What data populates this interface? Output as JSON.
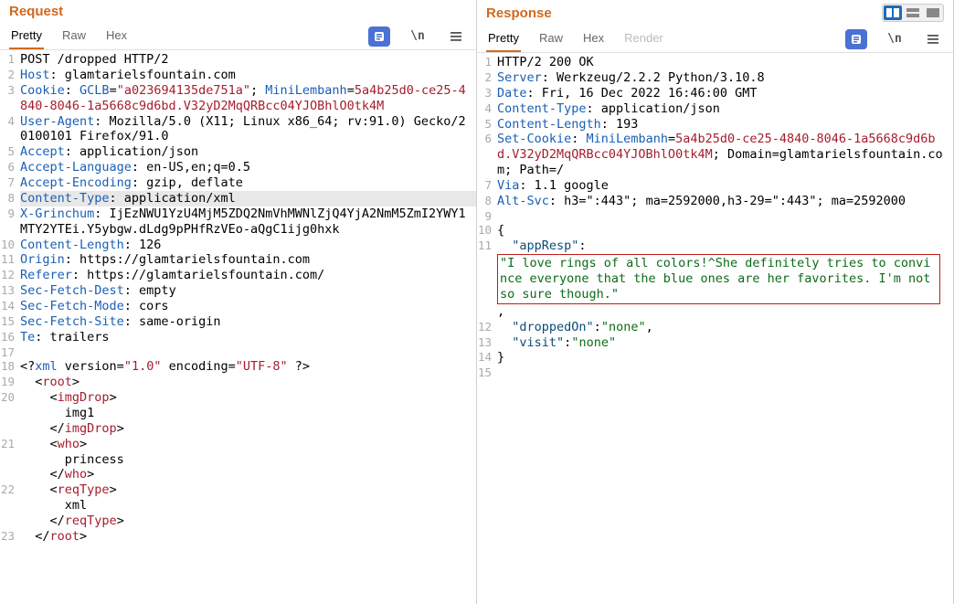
{
  "request": {
    "title": "Request",
    "tabs": {
      "pretty": "Pretty",
      "raw": "Raw",
      "hex": "Hex"
    },
    "tool_newline": "\\n",
    "lines": [
      {
        "n": "1",
        "spans": [
          {
            "t": "POST /dropped HTTP/2"
          }
        ]
      },
      {
        "n": "2",
        "spans": [
          {
            "t": "Host",
            "c": "hk"
          },
          {
            "t": ": glamtarielsfountain.com"
          }
        ]
      },
      {
        "n": "3",
        "spans": [
          {
            "t": "Cookie",
            "c": "hk"
          },
          {
            "t": ": "
          },
          {
            "t": "GCLB",
            "c": "hk"
          },
          {
            "t": "="
          },
          {
            "t": "\"a023694135de751a\"",
            "c": "cs"
          },
          {
            "t": "; "
          },
          {
            "t": "MiniLembanh",
            "c": "hk"
          },
          {
            "t": "="
          },
          {
            "t": "5a4b25d0-ce25-4840-8046-1a5668c9d6bd.V32yD2MqQRBcc04YJOBhlO0tk4M",
            "c": "cs"
          }
        ]
      },
      {
        "n": "4",
        "spans": [
          {
            "t": "User-Agent",
            "c": "hk"
          },
          {
            "t": ": Mozilla/5.0 (X11; Linux x86_64; rv:91.0) Gecko/20100101 Firefox/91.0"
          }
        ]
      },
      {
        "n": "5",
        "spans": [
          {
            "t": "Accept",
            "c": "hk"
          },
          {
            "t": ": application/json"
          }
        ]
      },
      {
        "n": "6",
        "spans": [
          {
            "t": "Accept-Language",
            "c": "hk"
          },
          {
            "t": ": en-US,en;q=0.5"
          }
        ]
      },
      {
        "n": "7",
        "spans": [
          {
            "t": "Accept-Encoding",
            "c": "hk"
          },
          {
            "t": ": gzip, deflate"
          }
        ]
      },
      {
        "n": "8",
        "hl": true,
        "spans": [
          {
            "t": "Content-Type",
            "c": "hk"
          },
          {
            "t": ": application/xml"
          }
        ]
      },
      {
        "n": "9",
        "spans": [
          {
            "t": "X-Grinchum",
            "c": "hk"
          },
          {
            "t": ": IjEzNWU1YzU4MjM5ZDQ2NmVhMWNlZjQ4YjA2NmM5ZmI2YWY1MTY2YTEi.Y5ybgw.dLdg9pPHfRzVEo-aQgC1ijg0hxk"
          }
        ]
      },
      {
        "n": "10",
        "spans": [
          {
            "t": "Content-Length",
            "c": "hk"
          },
          {
            "t": ": 126"
          }
        ]
      },
      {
        "n": "11",
        "spans": [
          {
            "t": "Origin",
            "c": "hk"
          },
          {
            "t": ": https://glamtarielsfountain.com"
          }
        ]
      },
      {
        "n": "12",
        "spans": [
          {
            "t": "Referer",
            "c": "hk"
          },
          {
            "t": ": https://glamtarielsfountain.com/"
          }
        ]
      },
      {
        "n": "13",
        "spans": [
          {
            "t": "Sec-Fetch-Dest",
            "c": "hk"
          },
          {
            "t": ": empty"
          }
        ]
      },
      {
        "n": "14",
        "spans": [
          {
            "t": "Sec-Fetch-Mode",
            "c": "hk"
          },
          {
            "t": ": cors"
          }
        ]
      },
      {
        "n": "15",
        "spans": [
          {
            "t": "Sec-Fetch-Site",
            "c": "hk"
          },
          {
            "t": ": same-origin"
          }
        ]
      },
      {
        "n": "16",
        "spans": [
          {
            "t": "Te",
            "c": "hk"
          },
          {
            "t": ": trailers"
          }
        ]
      },
      {
        "n": "17",
        "spans": [
          {
            "t": ""
          }
        ]
      },
      {
        "n": "18",
        "spans": [
          {
            "t": "<?"
          },
          {
            "t": "xml",
            "c": "hk"
          },
          {
            "t": " version="
          },
          {
            "t": "\"1.0\"",
            "c": "cs"
          },
          {
            "t": " encoding="
          },
          {
            "t": "\"UTF-8\"",
            "c": "cs"
          },
          {
            "t": " ?>"
          }
        ]
      },
      {
        "n": "19",
        "spans": [
          {
            "t": "  <"
          },
          {
            "t": "root",
            "c": "cs"
          },
          {
            "t": ">"
          }
        ]
      },
      {
        "n": "20",
        "spans": [
          {
            "t": "    <"
          },
          {
            "t": "imgDrop",
            "c": "cs"
          },
          {
            "t": ">\n      img1\n    </"
          },
          {
            "t": "imgDrop",
            "c": "cs"
          },
          {
            "t": ">"
          }
        ]
      },
      {
        "n": "21",
        "spans": [
          {
            "t": "    <"
          },
          {
            "t": "who",
            "c": "cs"
          },
          {
            "t": ">\n      princess\n    </"
          },
          {
            "t": "who",
            "c": "cs"
          },
          {
            "t": ">"
          }
        ]
      },
      {
        "n": "22",
        "spans": [
          {
            "t": "    <"
          },
          {
            "t": "reqType",
            "c": "cs"
          },
          {
            "t": ">\n      xml\n    </"
          },
          {
            "t": "reqType",
            "c": "cs"
          },
          {
            "t": ">"
          }
        ]
      },
      {
        "n": "23",
        "spans": [
          {
            "t": "  </"
          },
          {
            "t": "root",
            "c": "cs"
          },
          {
            "t": ">"
          }
        ]
      }
    ]
  },
  "response": {
    "title": "Response",
    "tabs": {
      "pretty": "Pretty",
      "raw": "Raw",
      "hex": "Hex",
      "render": "Render"
    },
    "tool_newline": "\\n",
    "lines": [
      {
        "n": "1",
        "spans": [
          {
            "t": "HTTP/2 200 OK"
          }
        ]
      },
      {
        "n": "2",
        "spans": [
          {
            "t": "Server",
            "c": "hk"
          },
          {
            "t": ": Werkzeug/2.2.2 Python/3.10.8"
          }
        ]
      },
      {
        "n": "3",
        "spans": [
          {
            "t": "Date",
            "c": "hk"
          },
          {
            "t": ": Fri, 16 Dec 2022 16:46:00 GMT"
          }
        ]
      },
      {
        "n": "4",
        "spans": [
          {
            "t": "Content-Type",
            "c": "hk"
          },
          {
            "t": ": application/json"
          }
        ]
      },
      {
        "n": "5",
        "spans": [
          {
            "t": "Content-Length",
            "c": "hk"
          },
          {
            "t": ": 193"
          }
        ]
      },
      {
        "n": "6",
        "spans": [
          {
            "t": "Set-Cookie",
            "c": "hk"
          },
          {
            "t": ": "
          },
          {
            "t": "MiniLembanh",
            "c": "hk"
          },
          {
            "t": "="
          },
          {
            "t": "5a4b25d0-ce25-4840-8046-1a5668c9d6bd.V32yD2MqQRBcc04YJOBhlO0tk4M",
            "c": "cs"
          },
          {
            "t": "; Domain=glamtarielsfountain.com; Path=/"
          }
        ]
      },
      {
        "n": "7",
        "spans": [
          {
            "t": "Via",
            "c": "hk"
          },
          {
            "t": ": 1.1 google"
          }
        ]
      },
      {
        "n": "8",
        "spans": [
          {
            "t": "Alt-Svc",
            "c": "hk"
          },
          {
            "t": ": h3=\":443\"; ma=2592000,h3-29=\":443\"; ma=2592000"
          }
        ]
      },
      {
        "n": "9",
        "spans": [
          {
            "t": ""
          }
        ]
      },
      {
        "n": "10",
        "spans": [
          {
            "t": "{"
          }
        ]
      },
      {
        "n": "11",
        "box": true,
        "spans": [
          {
            "t": "  "
          },
          {
            "t": "\"appResp\"",
            "c": "jb"
          },
          {
            "t": ":\n"
          },
          {
            "t": "\"I love rings of all colors!^She definitely tries to convince everyone that the blue ones are her favorites. I'm not so sure though.\"",
            "c": "jg",
            "boxed": true
          },
          {
            "t": ","
          }
        ]
      },
      {
        "n": "12",
        "spans": [
          {
            "t": "  "
          },
          {
            "t": "\"droppedOn\"",
            "c": "jb"
          },
          {
            "t": ":"
          },
          {
            "t": "\"none\"",
            "c": "jg"
          },
          {
            "t": ","
          }
        ]
      },
      {
        "n": "13",
        "spans": [
          {
            "t": "  "
          },
          {
            "t": "\"visit\"",
            "c": "jb"
          },
          {
            "t": ":"
          },
          {
            "t": "\"none\"",
            "c": "jg"
          }
        ]
      },
      {
        "n": "14",
        "spans": [
          {
            "t": "}"
          }
        ]
      },
      {
        "n": "15",
        "spans": [
          {
            "t": ""
          }
        ]
      }
    ]
  }
}
